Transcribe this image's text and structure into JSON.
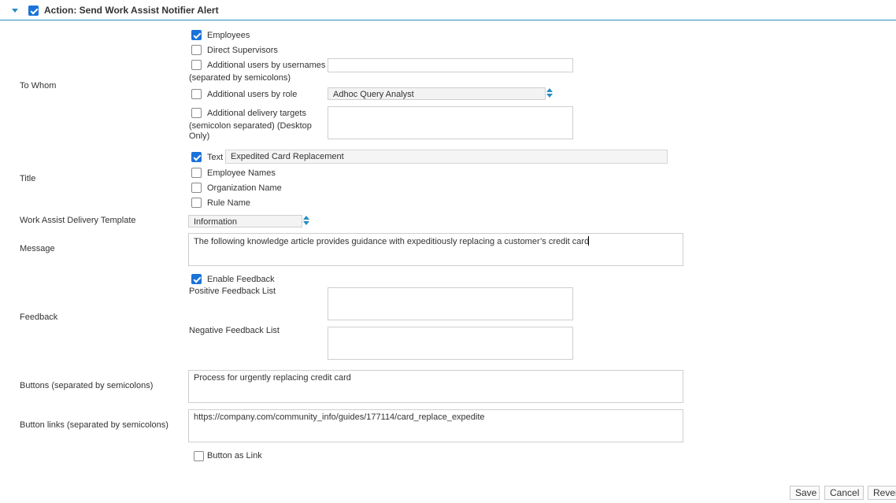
{
  "header": {
    "title": "Action: Send Work Assist Notifier Alert",
    "enabled": true,
    "accent_color": "#2a8bbf"
  },
  "to_whom": {
    "label": "To Whom",
    "employees": {
      "label": "Employees",
      "checked": true
    },
    "direct_supervisors": {
      "label": "Direct Supervisors",
      "checked": false
    },
    "additional_usernames": {
      "label": "Additional users by usernames",
      "hint": "(separated by semicolons)",
      "value": "",
      "checked": false
    },
    "additional_role": {
      "label": "Additional users by role",
      "selected": "Adhoc Query Analyst",
      "checked": false
    },
    "delivery_targets": {
      "label": "Additional delivery targets",
      "hint_line1": "(semicolon separated) (Desktop",
      "hint_line2": "Only)",
      "value": "",
      "checked": false
    }
  },
  "title_section": {
    "label": "Title",
    "text": {
      "label": "Text",
      "checked": true,
      "value": "Expedited Card Replacement"
    },
    "employee_names": {
      "label": "Employee Names",
      "checked": false
    },
    "organization_name": {
      "label": "Organization Name",
      "checked": false
    },
    "rule_name": {
      "label": "Rule Name",
      "checked": false
    }
  },
  "template": {
    "label": "Work Assist Delivery Template",
    "selected": "Information"
  },
  "message": {
    "label": "Message",
    "value": "The following knowledge article provides guidance with expeditiously replacing a customer’s credit card"
  },
  "feedback": {
    "label": "Feedback",
    "enable": {
      "label": "Enable Feedback",
      "checked": true
    },
    "positive_label": "Positive Feedback List",
    "positive_value": "",
    "negative_label": "Negative Feedback List",
    "negative_value": ""
  },
  "buttons": {
    "label": "Buttons (separated by semicolons)",
    "value": "Process for urgently replacing credit card"
  },
  "button_links": {
    "label": "Button links (separated by semicolons)",
    "value": "https://company.com/community_info/guides/177114/card_replace_expedite"
  },
  "button_as_link": {
    "label": "Button as Link",
    "checked": false
  },
  "footer": {
    "save": "Save",
    "cancel": "Cancel",
    "revert": "Rever"
  },
  "colors": {
    "checkbox_on": "#1a73d9",
    "accent": "#2a8bbf"
  }
}
